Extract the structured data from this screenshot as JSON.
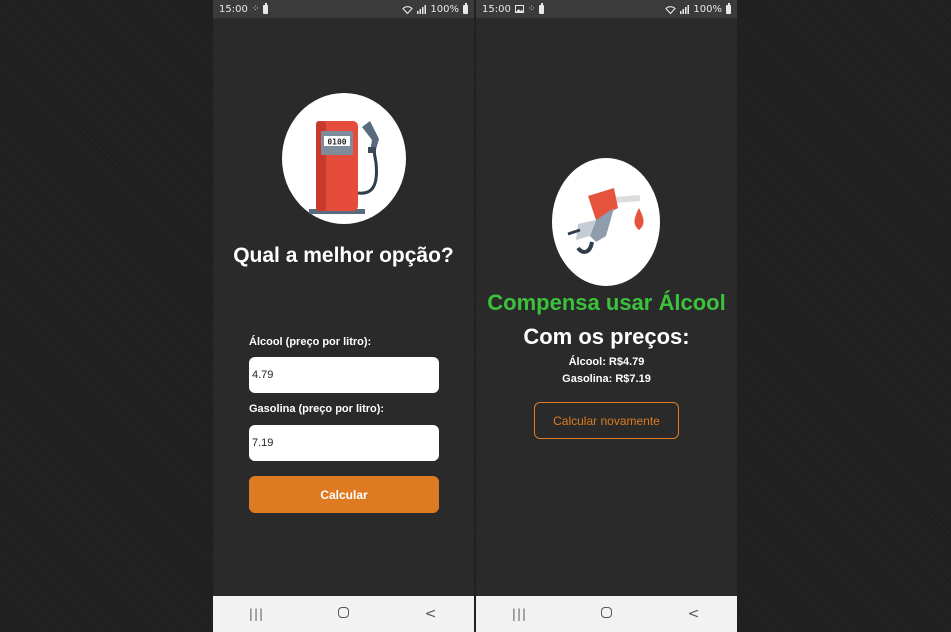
{
  "colors": {
    "accent": "#dd7a22",
    "success": "#3cc13c",
    "background": "#2a2a2a",
    "status_bar": "#3b3b3b",
    "nav_bar": "#f2f2f2"
  },
  "left_screen": {
    "status_bar": {
      "time": "15:00",
      "battery": "100%",
      "icons": [
        "grid-icon",
        "battery-saver-icon",
        "wifi-icon",
        "signal-icon",
        "battery-icon"
      ]
    },
    "logo": "fuel-pump-icon",
    "title": "Qual a melhor opção?",
    "alcool_label": "Álcool (preço por litro):",
    "alcool_value": "4.79",
    "gasolina_label": "Gasolina (preço por litro):",
    "gasolina_value": "7.19",
    "calcular_label": "Calcular",
    "nav": {
      "recent": "|||",
      "back": "<"
    }
  },
  "right_screen": {
    "status_bar": {
      "time": "15:00",
      "battery": "100%",
      "icons": [
        "image-icon",
        "grid-icon",
        "battery-saver-icon",
        "wifi-icon",
        "signal-icon",
        "battery-icon"
      ]
    },
    "logo": "fuel-nozzle-icon",
    "result": "Compensa usar Álcool",
    "prices_heading": "Com os preços:",
    "alcool_price": "Álcool: R$4.79",
    "gasolina_price": "Gasolina: R$7.19",
    "recalc_label": "Calcular novamente",
    "nav": {
      "recent": "|||",
      "back": "<"
    }
  }
}
